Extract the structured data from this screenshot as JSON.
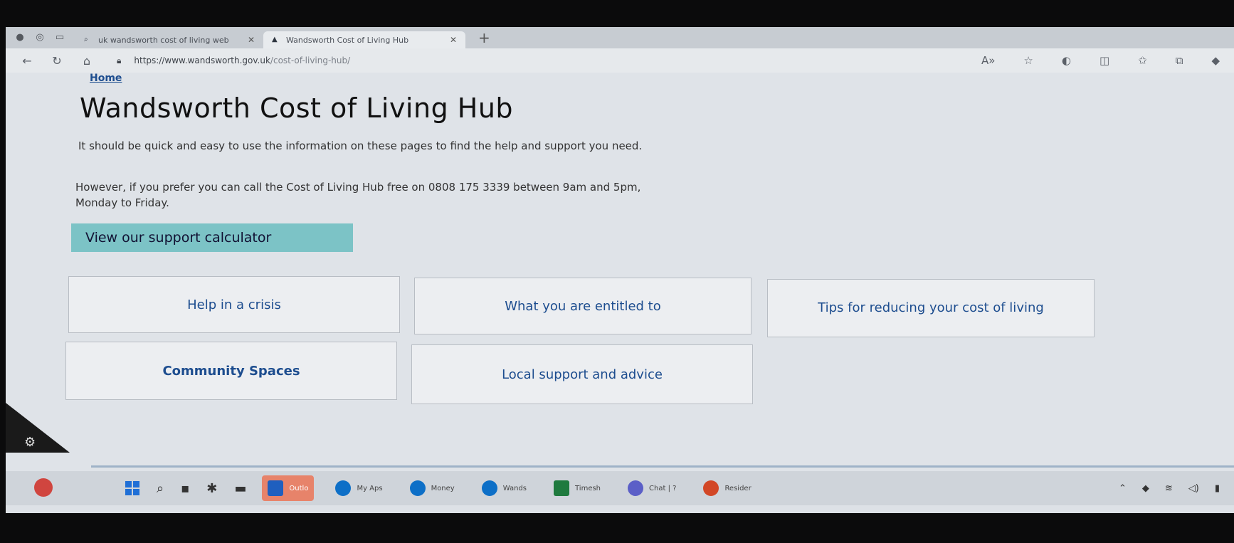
{
  "browser": {
    "tabs": [
      {
        "label": "uk wandsworth cost of living web",
        "active": false
      },
      {
        "label": "Wandsworth Cost of Living Hub",
        "active": true
      }
    ],
    "url_host": "https://www.wandsworth.gov.uk",
    "url_path": "/cost-of-living-hub/"
  },
  "page": {
    "breadcrumb_home": "Home",
    "title": "Wandsworth Cost of Living Hub",
    "intro": "It should be quick and easy to use the information on these pages to find the help and support you need.",
    "phone_text": "However, if you prefer you can call the Cost of Living Hub free on 0808 175 3339 between 9am and 5pm, Monday to Friday.",
    "calculator_button": "View our support calculator",
    "tiles": [
      "Help in a crisis",
      "What you are entitled to",
      "Tips for reducing your cost of living",
      "Community Spaces",
      "Local support and advice"
    ]
  },
  "taskbar": {
    "apps": [
      {
        "label": "Outlo",
        "icon": "outlook-icon"
      },
      {
        "label": "My Aps",
        "icon": "edge-icon"
      },
      {
        "label": "Money",
        "icon": "edge-icon"
      },
      {
        "label": "Wands",
        "icon": "edge-icon"
      },
      {
        "label": "Timesh",
        "icon": "excel-icon"
      },
      {
        "label": "Chat | ?",
        "icon": "teams-icon"
      },
      {
        "label": "Resider",
        "icon": "powerpoint-icon"
      }
    ]
  },
  "colors": {
    "link": "#1d4d8f",
    "calculator_bg": "#7cc3c6",
    "tile_bg": "#eceef1"
  }
}
